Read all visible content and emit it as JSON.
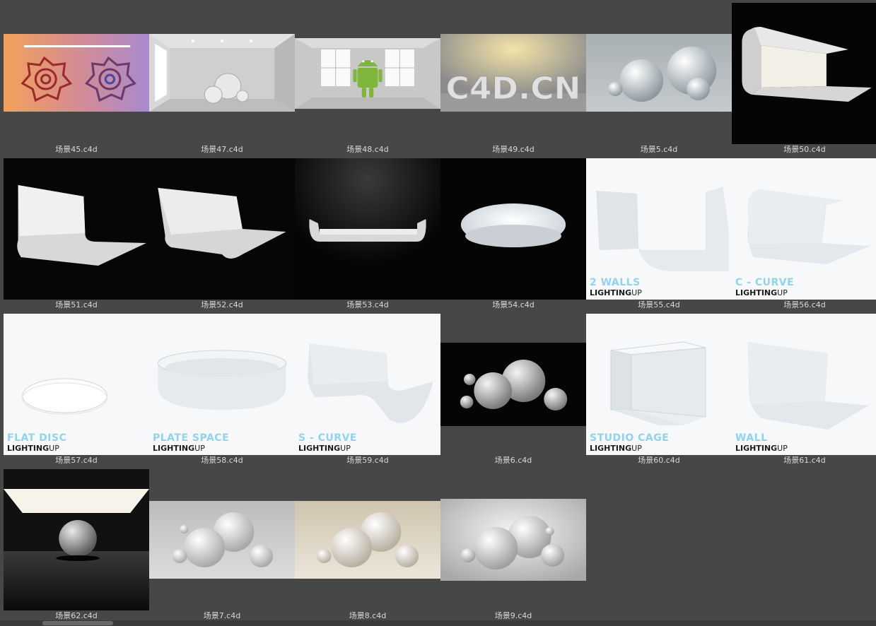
{
  "items": [
    {
      "id": "s45",
      "filename": "场景45.c4d"
    },
    {
      "id": "s47",
      "filename": "场景47.c4d"
    },
    {
      "id": "s48",
      "filename": "场景48.c4d"
    },
    {
      "id": "s49",
      "filename": "场景49.c4d",
      "watermark": "C4D.CN"
    },
    {
      "id": "s5",
      "filename": "场景5.c4d"
    },
    {
      "id": "s50",
      "filename": "场景50.c4d"
    },
    {
      "id": "s51",
      "filename": "场景51.c4d"
    },
    {
      "id": "s52",
      "filename": "场景52.c4d"
    },
    {
      "id": "s53",
      "filename": "场景53.c4d"
    },
    {
      "id": "s54",
      "filename": "场景54.c4d"
    },
    {
      "id": "s55",
      "filename": "场景55.c4d",
      "overlay_title": "2 WALLS"
    },
    {
      "id": "s56",
      "filename": "场景56.c4d",
      "overlay_title": "C - CURVE"
    },
    {
      "id": "s57",
      "filename": "场景57.c4d",
      "overlay_title": "FLAT DISC"
    },
    {
      "id": "s58",
      "filename": "场景58.c4d",
      "overlay_title": "PLATE SPACE"
    },
    {
      "id": "s59",
      "filename": "场景59.c4d",
      "overlay_title": "S - CURVE"
    },
    {
      "id": "s6",
      "filename": "场景6.c4d"
    },
    {
      "id": "s60",
      "filename": "场景60.c4d",
      "overlay_title": "STUDIO CAGE"
    },
    {
      "id": "s61",
      "filename": "场景61.c4d",
      "overlay_title": "WALL"
    },
    {
      "id": "s62",
      "filename": "场景62.c4d"
    },
    {
      "id": "s7",
      "filename": "场景7.c4d"
    },
    {
      "id": "s8",
      "filename": "场景8.c4d"
    },
    {
      "id": "s9",
      "filename": "场景9.c4d"
    }
  ],
  "brand": {
    "bold": "LIGHTING",
    "light": "UP"
  }
}
